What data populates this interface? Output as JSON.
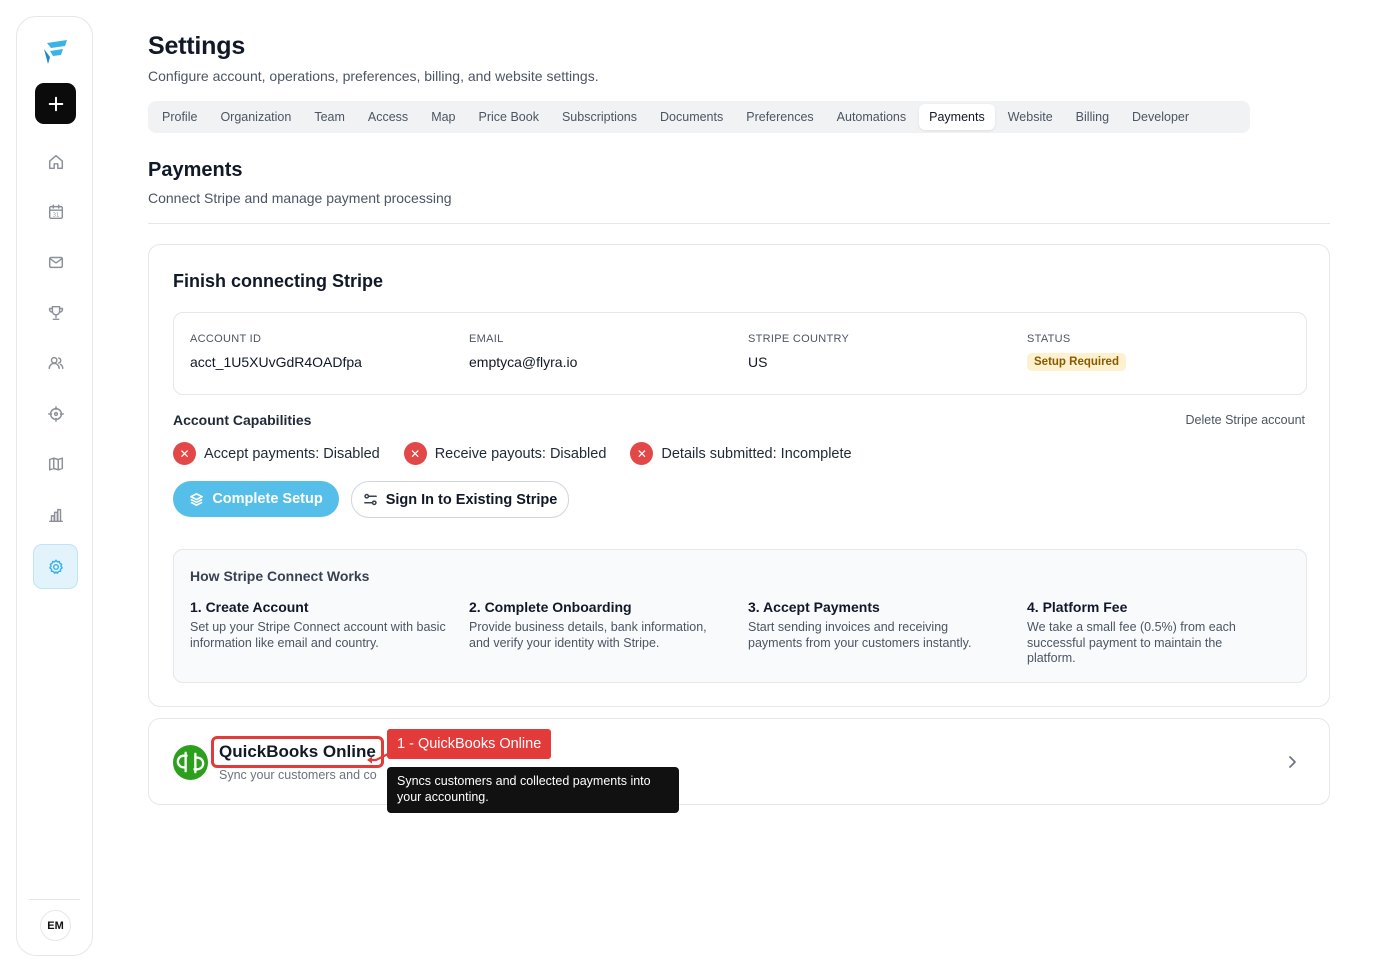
{
  "sidebar": {
    "nav": [
      {
        "icon": "home-icon"
      },
      {
        "icon": "calendar-icon"
      },
      {
        "icon": "mail-icon"
      },
      {
        "icon": "trophy-icon"
      },
      {
        "icon": "users-icon"
      },
      {
        "icon": "crosshair-icon"
      },
      {
        "icon": "map-icon"
      },
      {
        "icon": "bar-chart-icon"
      },
      {
        "icon": "gear-icon"
      }
    ],
    "calendar_day": "31",
    "avatar_initials": "EM"
  },
  "header": {
    "title": "Settings",
    "subtitle": "Configure account, operations, preferences, billing, and website settings."
  },
  "tabs": [
    {
      "label": "Profile"
    },
    {
      "label": "Organization"
    },
    {
      "label": "Team"
    },
    {
      "label": "Access"
    },
    {
      "label": "Map"
    },
    {
      "label": "Price Book"
    },
    {
      "label": "Subscriptions"
    },
    {
      "label": "Documents"
    },
    {
      "label": "Preferences"
    },
    {
      "label": "Automations"
    },
    {
      "label": "Payments"
    },
    {
      "label": "Website"
    },
    {
      "label": "Billing"
    },
    {
      "label": "Developer"
    }
  ],
  "active_tab": "Payments",
  "section": {
    "title": "Payments",
    "subtitle": "Connect Stripe and manage payment processing"
  },
  "stripe": {
    "title": "Finish connecting Stripe",
    "account": {
      "id_label": "ACCOUNT ID",
      "id_value": "acct_1U5XUvGdR4OADfpa",
      "email_label": "EMAIL",
      "email_value": "emptyca@flyra.io",
      "country_label": "STRIPE COUNTRY",
      "country_value": "US",
      "status_label": "STATUS",
      "status_value": "Setup Required"
    },
    "capabilities_title": "Account Capabilities",
    "delete_label": "Delete Stripe account",
    "capabilities": [
      {
        "text": "Accept payments: Disabled"
      },
      {
        "text": "Receive payouts: Disabled"
      },
      {
        "text": "Details submitted: Incomplete"
      }
    ],
    "complete_setup_label": "Complete Setup",
    "sign_in_label": "Sign In to Existing Stripe",
    "how": {
      "title": "How Stripe Connect Works",
      "steps": [
        {
          "title": "1. Create Account",
          "desc": "Set up your Stripe Connect account with basic information like email and country."
        },
        {
          "title": "2. Complete Onboarding",
          "desc": "Provide business details, bank information, and verify your identity with Stripe."
        },
        {
          "title": "3. Accept Payments",
          "desc": "Start sending invoices and receiving payments from your customers instantly."
        },
        {
          "title": "4. Platform Fee",
          "desc": "We take a small fee (0.5%) from each successful payment to maintain the platform."
        }
      ]
    }
  },
  "quickbooks": {
    "name": "QuickBooks Online",
    "desc": "Sync your customers and co"
  },
  "annotation": {
    "label": "1 - QuickBooks Online",
    "tooltip": "Syncs customers and collected payments into your accounting."
  },
  "colors": {
    "accent": "#55bfea",
    "danger": "#e24848",
    "quickbooks_green": "#2ca01c",
    "annotation_red": "#e33a3a"
  }
}
